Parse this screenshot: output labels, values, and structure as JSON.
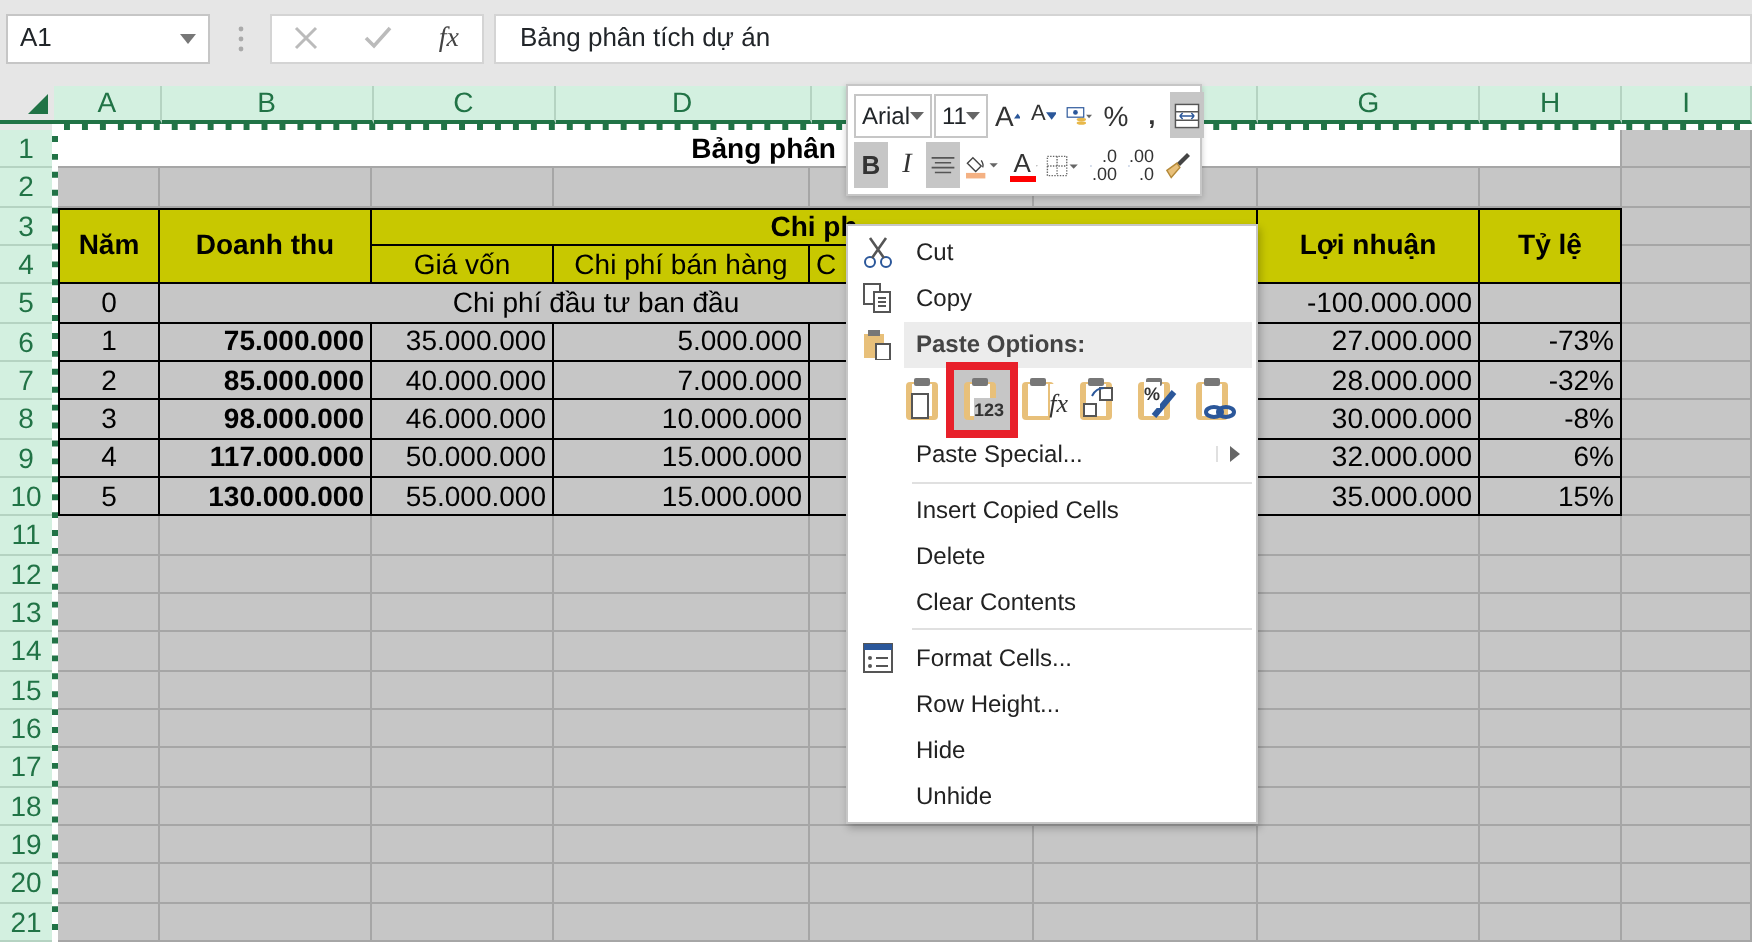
{
  "formula_bar": {
    "name_box": "A1",
    "function_label": "fx",
    "formula": "Bảng phân tích dự án"
  },
  "column_headers": [
    "A",
    "B",
    "C",
    "D",
    "G",
    "H",
    "I"
  ],
  "row_headers": [
    "1",
    "2",
    "3",
    "4",
    "5",
    "6",
    "7",
    "8",
    "9",
    "10",
    "11",
    "12",
    "13",
    "14",
    "15",
    "16",
    "17",
    "18",
    "19",
    "20",
    "21"
  ],
  "sheet": {
    "title": "Bảng phân",
    "header": {
      "year": "Năm",
      "revenue": "Doanh thu",
      "costs": "Chi ph",
      "cost_of_goods": "Giá vốn",
      "selling_cost": "Chi phí bán hàng",
      "column_e": "C",
      "profit": "Lợi nhuận",
      "ratio": "Tỷ lệ"
    },
    "initial_row": {
      "year": "0",
      "note": "Chi phí đầu tư ban đầu",
      "profit": "-100.000.000"
    },
    "rows": [
      {
        "year": "1",
        "revenue": "75.000.000",
        "cost_of_goods": "35.000.000",
        "selling_cost": "5.000.000",
        "profit": "27.000.000",
        "ratio": "-73%"
      },
      {
        "year": "2",
        "revenue": "85.000.000",
        "cost_of_goods": "40.000.000",
        "selling_cost": "7.000.000",
        "profit": "28.000.000",
        "ratio": "-32%"
      },
      {
        "year": "3",
        "revenue": "98.000.000",
        "cost_of_goods": "46.000.000",
        "selling_cost": "10.000.000",
        "profit": "30.000.000",
        "ratio": "-8%"
      },
      {
        "year": "4",
        "revenue": "117.000.000",
        "cost_of_goods": "50.000.000",
        "selling_cost": "15.000.000",
        "profit": "32.000.000",
        "ratio": "6%"
      },
      {
        "year": "5",
        "revenue": "130.000.000",
        "cost_of_goods": "55.000.000",
        "selling_cost": "15.000.000",
        "profit": "35.000.000",
        "ratio": "15%"
      }
    ]
  },
  "mini_toolbar": {
    "font": "Arial",
    "size": "11",
    "row_1": [
      {
        "kind": "grow_font",
        "label": "A",
        "selected": false
      },
      {
        "kind": "shrink_font",
        "label": "A",
        "selected": false
      },
      {
        "kind": "accounting",
        "selected": false
      },
      {
        "kind": "percent",
        "label": "%",
        "selected": false
      },
      {
        "kind": "comma",
        "label": ",",
        "selected": false
      },
      {
        "kind": "merge",
        "selected": true
      }
    ],
    "row_2": [
      {
        "kind": "bold",
        "label": "B",
        "selected": true
      },
      {
        "kind": "italic",
        "label": "I",
        "selected": false
      },
      {
        "kind": "center",
        "selected": true
      },
      {
        "kind": "fill_color",
        "color": "#f4b183",
        "selected": false
      },
      {
        "kind": "font_color",
        "label": "A",
        "color": "#ff0000",
        "selected": false
      },
      {
        "kind": "borders",
        "selected": false
      },
      {
        "kind": "increase_decimal",
        "label_top": ".0",
        "label_bottom": ".00",
        "selected": false
      },
      {
        "kind": "decrease_decimal",
        "label_top": ".00",
        "label_bottom": ".0",
        "selected": false
      },
      {
        "kind": "format_painter",
        "selected": false
      }
    ]
  },
  "context_menu": [
    {
      "kind": "cut",
      "label": "Cut"
    },
    {
      "kind": "copy",
      "label": "Copy"
    },
    {
      "kind": "section",
      "label": "Paste Options:"
    },
    {
      "kind": "paste_options",
      "options": [
        {
          "kind": "paste",
          "selected": false
        },
        {
          "kind": "values",
          "label": "123",
          "selected": true
        },
        {
          "kind": "formulas",
          "label": "fx",
          "selected": false
        },
        {
          "kind": "transpose",
          "selected": false
        },
        {
          "kind": "formatting",
          "label": "%",
          "selected": false
        },
        {
          "kind": "link",
          "selected": false
        }
      ]
    },
    {
      "kind": "submenu_item",
      "label": "Paste Special..."
    },
    {
      "kind": "separator"
    },
    {
      "kind": "item",
      "label": "Insert Copied Cells"
    },
    {
      "kind": "item",
      "label": "Delete"
    },
    {
      "kind": "item",
      "label": "Clear Contents"
    },
    {
      "kind": "separator"
    },
    {
      "kind": "format_cells",
      "label": "Format Cells..."
    },
    {
      "kind": "item",
      "label": "Row Height..."
    },
    {
      "kind": "item",
      "label": "Hide"
    },
    {
      "kind": "item",
      "label": "Unhide"
    }
  ]
}
